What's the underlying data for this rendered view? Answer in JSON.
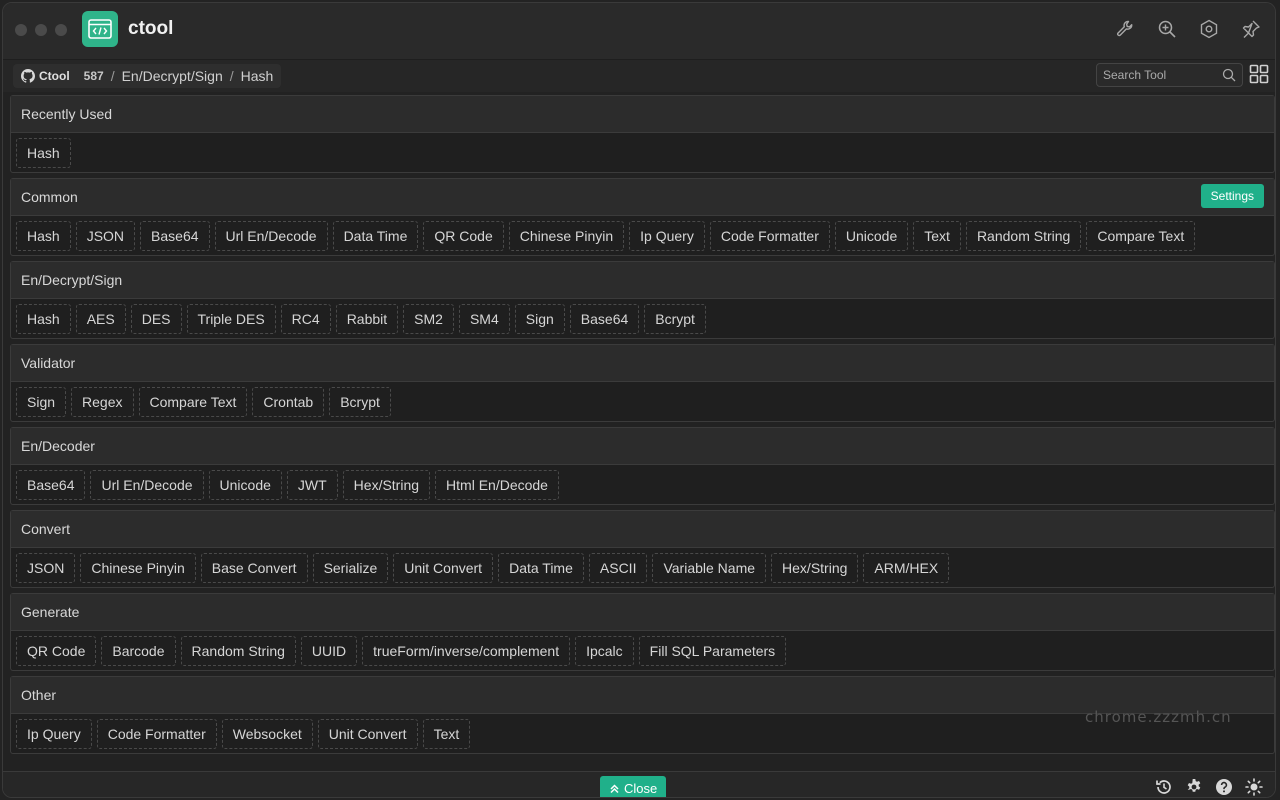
{
  "app": {
    "title": "ctool",
    "logo_icon": "code-window-icon"
  },
  "titlebar_icons": [
    "wrench-icon",
    "zoom-in-icon",
    "hexagon-settings-icon",
    "pin-icon"
  ],
  "breadcrumb": {
    "repo": "Ctool",
    "stars": "587",
    "category": "En/Decrypt/Sign",
    "tool": "Hash"
  },
  "search": {
    "placeholder": "Search Tool"
  },
  "sections": [
    {
      "title": "Recently Used",
      "items": [
        "Hash"
      ]
    },
    {
      "title": "Common",
      "action": "Settings",
      "items": [
        "Hash",
        "JSON",
        "Base64",
        "Url En/Decode",
        "Data Time",
        "QR Code",
        "Chinese Pinyin",
        "Ip Query",
        "Code Formatter",
        "Unicode",
        "Text",
        "Random String",
        "Compare Text"
      ]
    },
    {
      "title": "En/Decrypt/Sign",
      "items": [
        "Hash",
        "AES",
        "DES",
        "Triple DES",
        "RC4",
        "Rabbit",
        "SM2",
        "SM4",
        "Sign",
        "Base64",
        "Bcrypt"
      ]
    },
    {
      "title": "Validator",
      "items": [
        "Sign",
        "Regex",
        "Compare Text",
        "Crontab",
        "Bcrypt"
      ]
    },
    {
      "title": "En/Decoder",
      "items": [
        "Base64",
        "Url En/Decode",
        "Unicode",
        "JWT",
        "Hex/String",
        "Html En/Decode"
      ]
    },
    {
      "title": "Convert",
      "items": [
        "JSON",
        "Chinese Pinyin",
        "Base Convert",
        "Serialize",
        "Unit Convert",
        "Data Time",
        "ASCII",
        "Variable Name",
        "Hex/String",
        "ARM/HEX"
      ]
    },
    {
      "title": "Generate",
      "items": [
        "QR Code",
        "Barcode",
        "Random String",
        "UUID",
        "trueForm/inverse/complement",
        "Ipcalc",
        "Fill SQL Parameters"
      ]
    },
    {
      "title": "Other",
      "items": [
        "Ip Query",
        "Code Formatter",
        "Websocket",
        "Unit Convert",
        "Text"
      ]
    }
  ],
  "watermark": "chrome.zzzmh.cn",
  "footer": {
    "close_label": "Close",
    "icons": [
      "history-icon",
      "gear-icon",
      "help-icon",
      "theme-sun-icon"
    ]
  },
  "colors": {
    "accent": "#20b08a",
    "background": "#222222"
  }
}
